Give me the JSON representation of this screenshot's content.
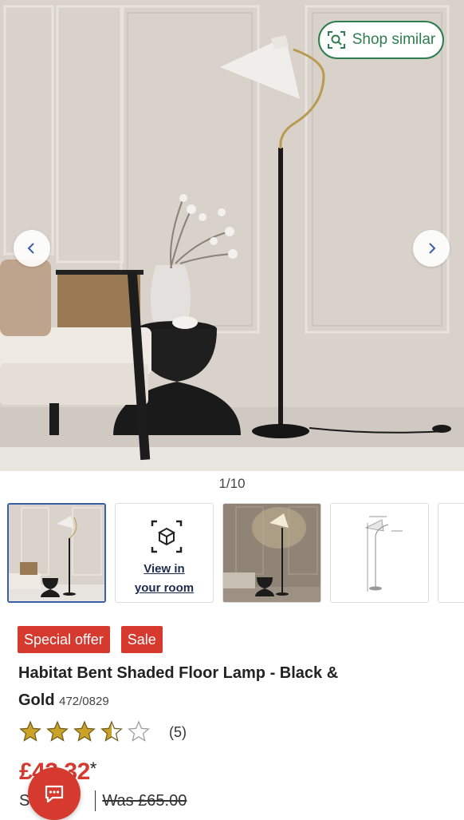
{
  "gallery": {
    "shop_similar_label": "Shop similar",
    "counter": "1/10",
    "ar_thumbnail_label_line1": "View in",
    "ar_thumbnail_label_line2": "your room"
  },
  "product": {
    "badges": [
      "Special offer",
      "Sale"
    ],
    "title": "Habitat Bent Shaded Floor Lamp - Black & Gold",
    "sku": "472/0829",
    "rating": {
      "value": 3.5,
      "max": 5,
      "count_label": "(5)"
    },
    "price": "£43.32",
    "price_suffix": "*",
    "save_label": "S",
    "was_price": "Was £65.00"
  },
  "colors": {
    "accent_green": "#2e7d4f",
    "sale_red": "#d63a2f",
    "star_gold": "#c9a227",
    "active_thumb_border": "#3b5ea8"
  },
  "icons": [
    "shop-similar-icon",
    "chevron-left-icon",
    "chevron-right-icon",
    "ar-cube-icon",
    "star-icon",
    "chat-icon"
  ]
}
